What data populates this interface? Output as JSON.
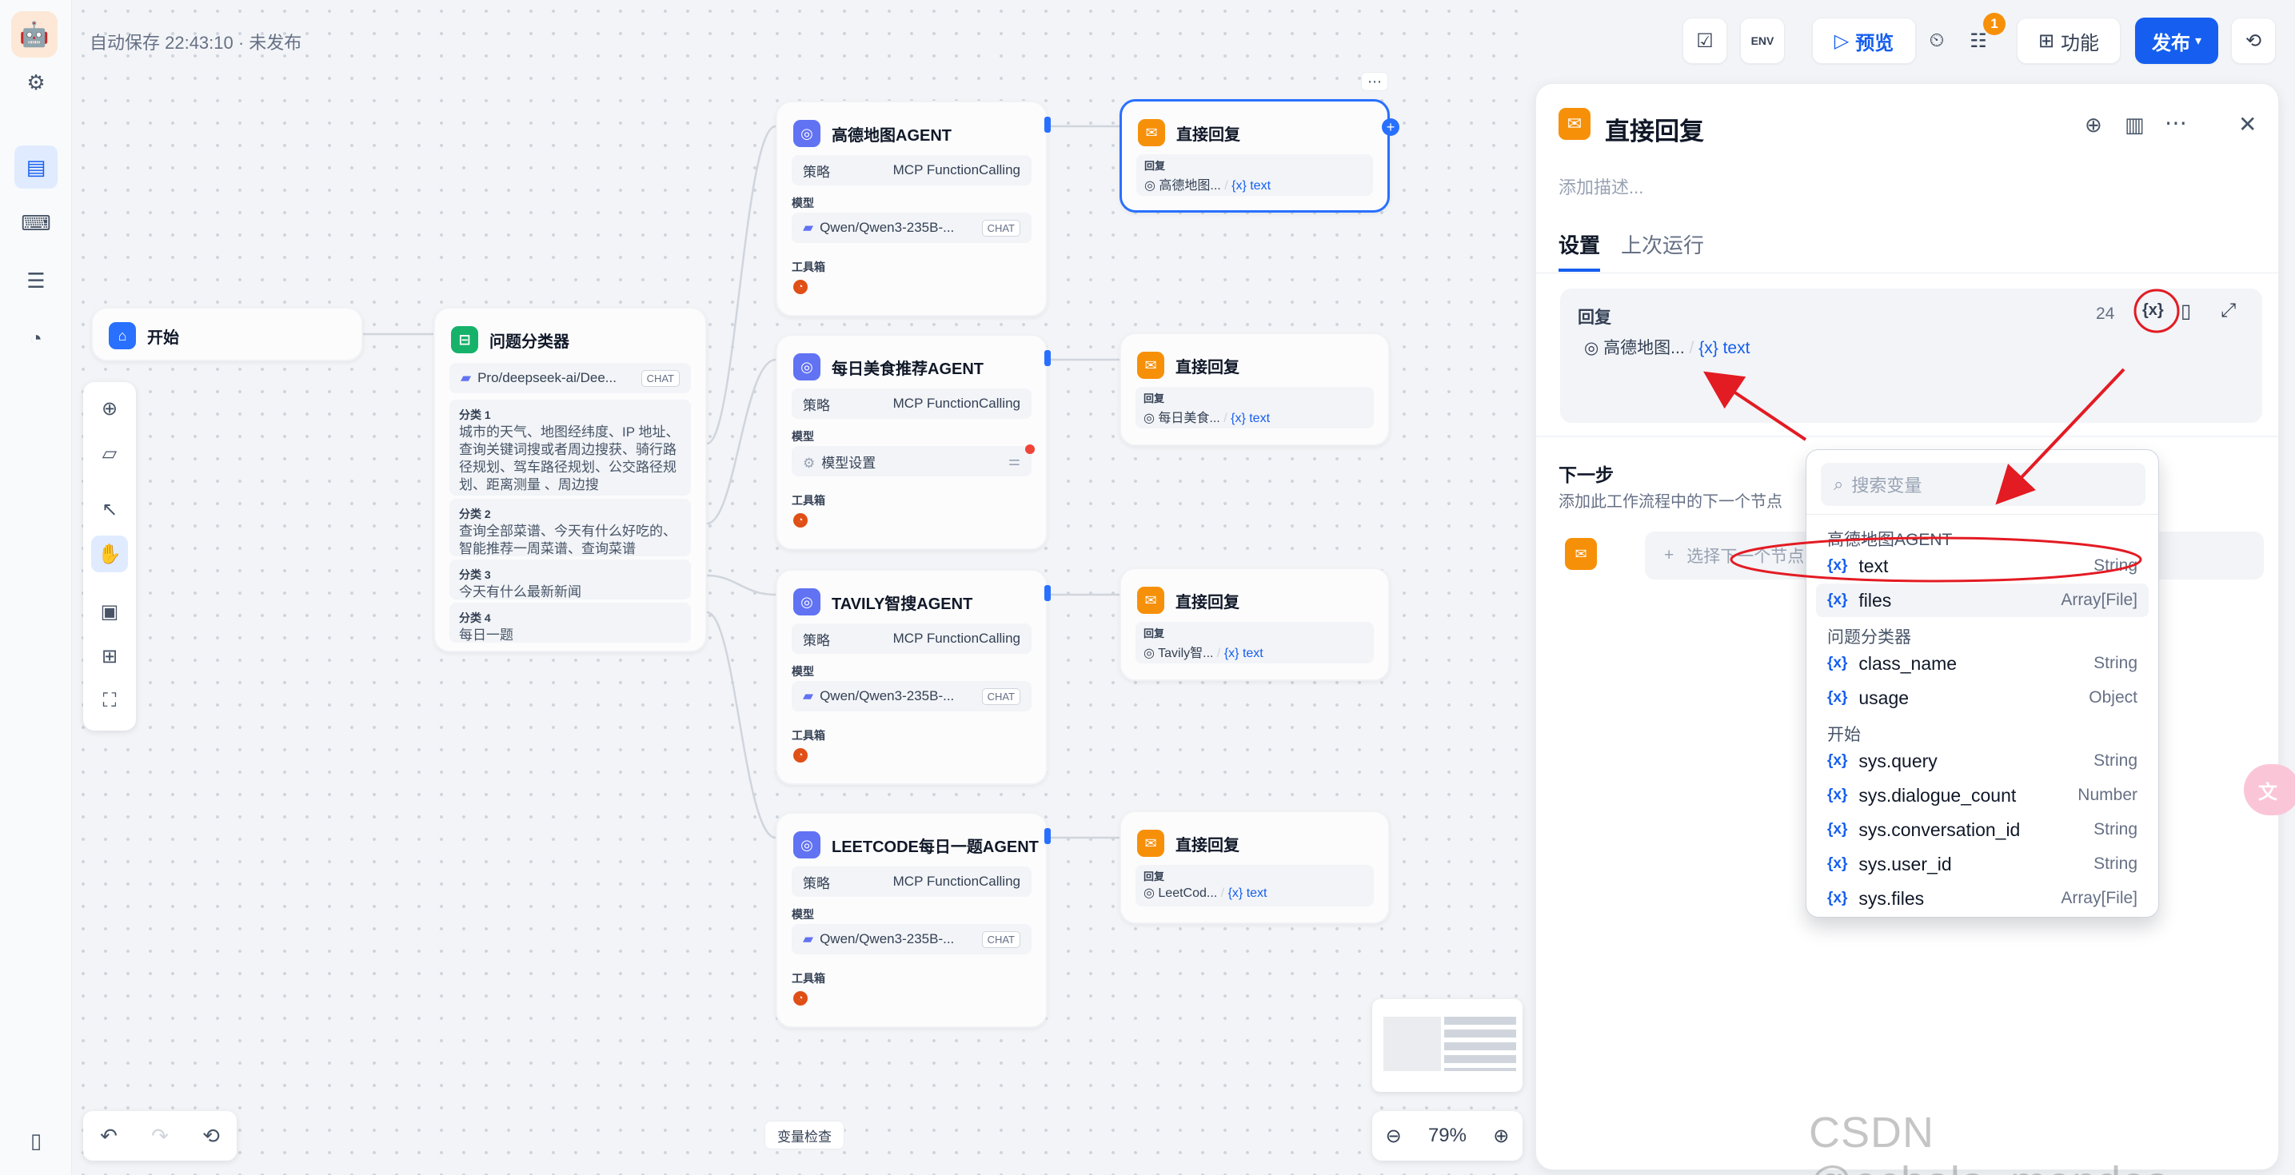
{
  "app": {
    "save_status": "自动保存 22:43:10 · 未发布"
  },
  "topbar": {
    "preview_label": "预览",
    "feature_label": "功能",
    "publish_label": "发布",
    "env_label": "ENV",
    "badge_count": "1"
  },
  "nodes": {
    "start": {
      "title": "开始"
    },
    "classifier": {
      "title": "问题分类器",
      "model": "Pro/deepseek-ai/Dee...",
      "model_tag": "CHAT",
      "classes": [
        {
          "label": "分类 1",
          "text": "城市的天气、地图经纬度、IP 地址、查询关键词搜或者周边搜获、骑行路径规划、驾车路径规划、公交路径规划、距离测量 、周边搜"
        },
        {
          "label": "分类 2",
          "text": "查询全部菜谱、今天有什么好吃的、智能推荐一周菜谱、查询菜谱"
        },
        {
          "label": "分类 3",
          "text": "今天有什么最新新闻"
        },
        {
          "label": "分类 4",
          "text": "每日一题"
        }
      ]
    },
    "agents": [
      {
        "title": "高德地图AGENT",
        "strategy_label": "策略",
        "strategy": "MCP FunctionCalling",
        "model_label": "模型",
        "model": "Qwen/Qwen3-235B-...",
        "model_tag": "CHAT",
        "tools_label": "工具箱"
      },
      {
        "title": "每日美食推荐AGENT",
        "strategy_label": "策略",
        "strategy": "MCP FunctionCalling",
        "model_label": "模型",
        "model": "模型设置",
        "model_tag": "",
        "tools_label": "工具箱"
      },
      {
        "title": "TAVILY智搜AGENT",
        "strategy_label": "策略",
        "strategy": "MCP FunctionCalling",
        "model_label": "模型",
        "model": "Qwen/Qwen3-235B-...",
        "model_tag": "CHAT",
        "tools_label": "工具箱"
      },
      {
        "title": "LEETCODE每日一题AGENT",
        "strategy_label": "策略",
        "strategy": "MCP FunctionCalling",
        "model_label": "模型",
        "model": "Qwen/Qwen3-235B-...",
        "model_tag": "CHAT",
        "tools_label": "工具箱"
      }
    ],
    "replies": [
      {
        "title": "直接回复",
        "label": "回复",
        "source": "高德地图...",
        "var": "{x} text"
      },
      {
        "title": "直接回复",
        "label": "回复",
        "source": "每日美食...",
        "var": "{x} text"
      },
      {
        "title": "直接回复",
        "label": "回复",
        "source": "Tavily智...",
        "var": "{x} text"
      },
      {
        "title": "直接回复",
        "label": "回复",
        "source": "LeetCod...",
        "var": "{x} text"
      }
    ]
  },
  "bottom": {
    "var_check": "变量检查",
    "zoom": "79%"
  },
  "panel": {
    "title": "直接回复",
    "desc_placeholder": "添加描述...",
    "tabs": [
      "设置",
      "上次运行"
    ],
    "reply_label": "回复",
    "reply_count": "24",
    "reply_source": "高德地图...",
    "reply_var": "{x} text",
    "next_title": "下一步",
    "next_desc": "添加此工作流程中的下一个节点",
    "next_select": "选择下一个节点"
  },
  "dropdown": {
    "search_placeholder": "搜索变量",
    "groups": [
      {
        "name": "高德地图AGENT",
        "items": [
          {
            "name": "text",
            "type": "String"
          },
          {
            "name": "files",
            "type": "Array[File]"
          }
        ]
      },
      {
        "name": "问题分类器",
        "items": [
          {
            "name": "class_name",
            "type": "String"
          },
          {
            "name": "usage",
            "type": "Object"
          }
        ]
      },
      {
        "name": "开始",
        "items": [
          {
            "name": "sys.query",
            "type": "String"
          },
          {
            "name": "sys.dialogue_count",
            "type": "Number"
          },
          {
            "name": "sys.conversation_id",
            "type": "String"
          },
          {
            "name": "sys.user_id",
            "type": "String"
          },
          {
            "name": "sys.files",
            "type": "Array[File]"
          }
        ]
      }
    ]
  },
  "watermark": "CSDN @echola_mendes",
  "colors": {
    "accent": "#155eef",
    "annotation": "#e31b23"
  }
}
